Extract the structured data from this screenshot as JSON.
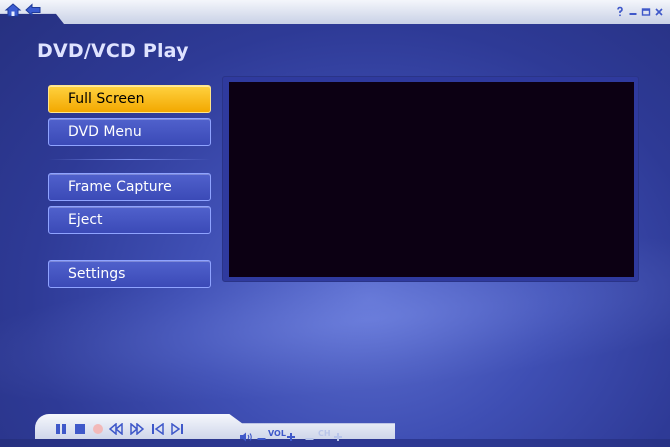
{
  "app": {
    "title": "DVD/VCD Play"
  },
  "menu": {
    "items": [
      {
        "label": "Full Screen"
      },
      {
        "label": "DVD Menu"
      },
      {
        "label": "Frame Capture"
      },
      {
        "label": "Eject"
      },
      {
        "label": "Settings"
      }
    ]
  },
  "controls": {
    "volume_label": "VOL",
    "channel_label": "CH"
  },
  "icons": [
    "home-icon",
    "back-arrow-icon",
    "help-icon",
    "minimize-icon",
    "maximize-icon",
    "close-icon",
    "pause-icon",
    "stop-icon",
    "record-icon",
    "rewind-icon",
    "fast-forward-icon",
    "previous-icon",
    "next-icon",
    "mute-icon",
    "volume-down-icon",
    "volume-up-icon",
    "channel-down-icon",
    "channel-up-icon"
  ],
  "colors": {
    "background": "#3f4fb4",
    "active_button": "#ffc21a",
    "button": "#4655c2",
    "video_area": "#0c0013",
    "accent_blue": "#3f58c9"
  }
}
